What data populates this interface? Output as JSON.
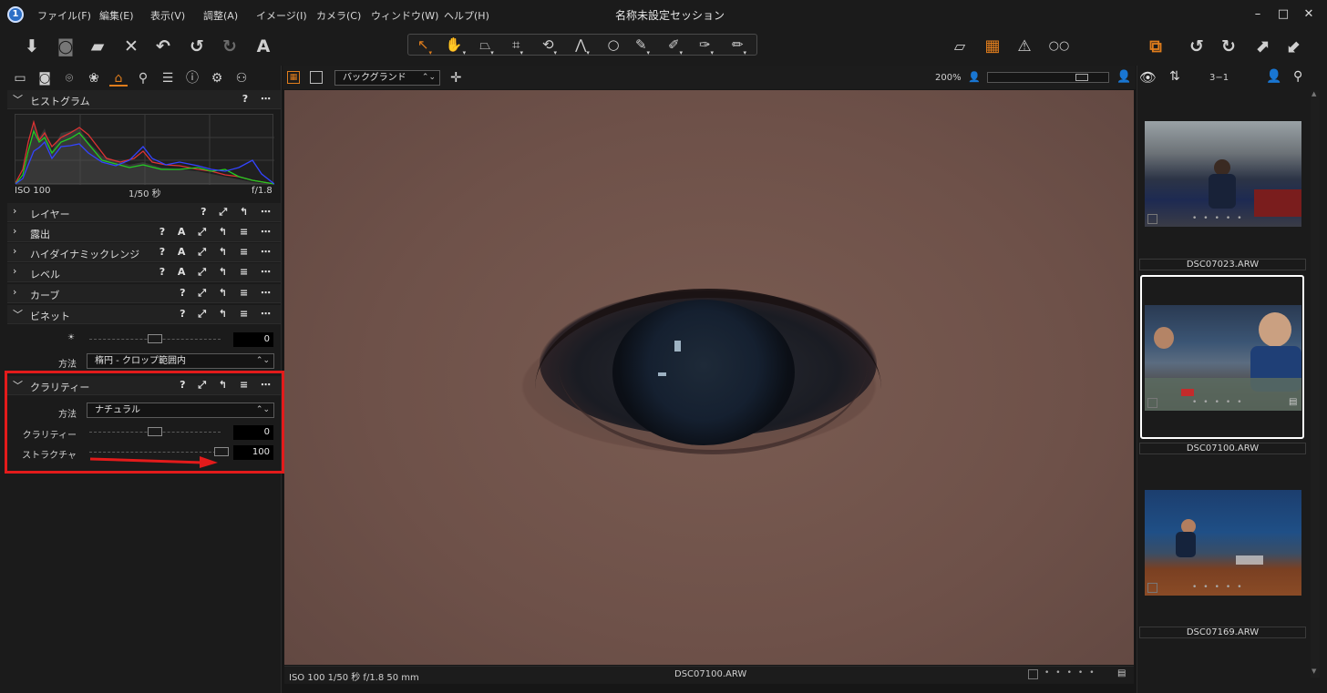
{
  "app": {
    "title": "名称未設定セッション",
    "icon": "1"
  },
  "menu": [
    "ファイル(F)",
    "編集(E)",
    "表示(V)",
    "調整(A)",
    "イメージ(I)",
    "カメラ(C)",
    "ウィンドウ(W)",
    "ヘルプ(H)"
  ],
  "window_buttons": {
    "minimize": "–",
    "maximize": "□",
    "close": "✕"
  },
  "toolbar_glyphs": {
    "import": "⬇",
    "capture": "◙",
    "open": "▰",
    "delete": "✕",
    "undo_all": "↶",
    "undo": "↺",
    "redo": "↻",
    "text": "A"
  },
  "cursor_tools": [
    "↖",
    "✋",
    "⏢",
    "⌗",
    "⟲",
    "⋀",
    "○",
    "✎",
    "✐",
    "✑",
    "✏"
  ],
  "right_tools": [
    "▱",
    "▦",
    "⚠",
    "○○"
  ],
  "far_right_tools": [
    "⧉",
    "↺",
    "↻",
    "⬈",
    "⬋"
  ],
  "tool_tabs": [
    "▭",
    "◙",
    "⌾",
    "❀",
    "⌂",
    "⚲",
    "☰",
    "ⓘ",
    "⚙",
    "⚇"
  ],
  "histogram": {
    "title": "ヒストグラム",
    "iso": "ISO 100",
    "shutter": "1/50 秒",
    "aperture": "f/1.8"
  },
  "tools": [
    {
      "label": "レイヤー",
      "actions": "? ⤢ ↰ ⋯"
    },
    {
      "label": "露出",
      "actions": "? A ⤢ ↰ ≡ ⋯"
    },
    {
      "label": "ハイダイナミックレンジ",
      "actions": "? A ⤢ ↰ ≡ ⋯"
    },
    {
      "label": "レベル",
      "actions": "? A ⤢ ↰ ≡ ⋯"
    },
    {
      "label": "カーブ",
      "actions": "? ⤢ ↰ ≡ ⋯"
    },
    {
      "label": "ビネット",
      "actions": "? ⤢ ↰ ≡ ⋯"
    }
  ],
  "vignette": {
    "amount_icon": "☀",
    "amount": "0",
    "method_label": "方法",
    "method_value": "楕円 - クロップ範囲内"
  },
  "clarity": {
    "title": "クラリティー",
    "actions": "? ⤢ ↰ ≡ ⋯",
    "method_label": "方法",
    "method_value": "ナチュラル",
    "clarity_label": "クラリティー",
    "clarity_value": "0",
    "structure_label": "ストラクチャ",
    "structure_value": "100"
  },
  "viewer": {
    "background_select": "バックグランド",
    "zoom": "200%",
    "status_left": "ISO 100 1/50 秒 f/1.8 50 mm",
    "status_file": "DSC07100.ARW"
  },
  "browser": {
    "count": "3−1"
  },
  "thumbnails": [
    {
      "name": "DSC07023.ARW",
      "selected": false
    },
    {
      "name": "DSC07100.ARW",
      "selected": true
    },
    {
      "name": "DSC07169.ARW",
      "selected": false
    }
  ],
  "colors": {
    "accent": "#e07d1c",
    "highlight_box": "#e31b1b",
    "panel_bg": "#1b1b1b"
  }
}
